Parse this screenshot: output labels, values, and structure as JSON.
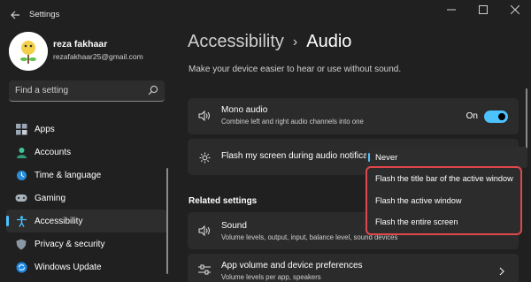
{
  "window": {
    "title": "Settings"
  },
  "profile": {
    "name": "reza fakhaar",
    "email": "rezafakhaar25@gmail.com"
  },
  "search": {
    "placeholder": "Find a setting"
  },
  "sidebar": {
    "items": [
      {
        "label": "Apps",
        "icon": "apps-icon"
      },
      {
        "label": "Accounts",
        "icon": "accounts-icon"
      },
      {
        "label": "Time & language",
        "icon": "time-language-icon"
      },
      {
        "label": "Gaming",
        "icon": "gaming-icon"
      },
      {
        "label": "Accessibility",
        "icon": "accessibility-icon",
        "active": true
      },
      {
        "label": "Privacy & security",
        "icon": "shield-icon"
      },
      {
        "label": "Windows Update",
        "icon": "windows-update-icon"
      }
    ]
  },
  "breadcrumb": {
    "parent": "Accessibility",
    "separator": "›",
    "current": "Audio"
  },
  "subtitle": "Make your device easier to hear or use without sound.",
  "mono_audio": {
    "title": "Mono audio",
    "description": "Combine left and right audio channels into one",
    "toggle_label": "On",
    "toggle_on": true
  },
  "flash": {
    "title": "Flash my screen during audio notifications",
    "selected": "Never",
    "options": [
      "Flash the title bar of the active window",
      "Flash the active window",
      "Flash the entire screen"
    ]
  },
  "related": {
    "heading": "Related settings",
    "sound": {
      "title": "Sound",
      "description": "Volume levels, output, input, balance level, sound devices"
    },
    "app_volume": {
      "title": "App volume and device preferences",
      "description": "Volume levels per app, speakers"
    }
  },
  "colors": {
    "accent": "#4cc2ff",
    "highlight_border": "#e0474c",
    "background": "#202020",
    "card": "#2b2b2b"
  }
}
